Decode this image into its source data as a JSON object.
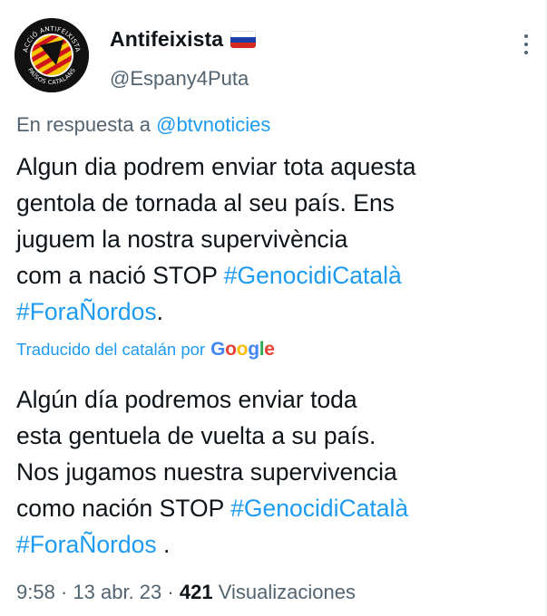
{
  "user": {
    "display_name": "Antifeixista",
    "handle": "@Espany4Puta",
    "flag_colors": [
      "#ffffff",
      "#1c3fa8",
      "#d52b1e"
    ],
    "avatar_texts": {
      "top": "ACCIÓ ANTIFEIXISTA",
      "bottom": "PAÏSOS CATALANS"
    }
  },
  "reply": {
    "prefix": "En respuesta a",
    "mention": "@btvnoticies"
  },
  "tweet": {
    "lines": [
      "Algun dia podrem enviar tota aquesta",
      "gentola de tornada al seu país. Ens",
      "juguem la nostra supervivència",
      "com a nació STOP "
    ],
    "hashtag1": "#GenocidiCatalà",
    "hashtag2": "#ForaÑordos",
    "end": "."
  },
  "translation": {
    "label": "Traducido del catalán por",
    "provider": "Google",
    "lines": [
      "Algún día podremos enviar toda",
      "esta gentuela de vuelta a su país.",
      "Nos jugamos nuestra supervivencia",
      "como nación STOP "
    ],
    "hashtag1": "#GenocidiCatalà",
    "hashtag2": "#ForaÑordos",
    "end": " ."
  },
  "meta": {
    "time": "9:58",
    "date": "13 abr. 23",
    "views_count": "421",
    "views_label": "Visualizaciones",
    "separator": "·"
  },
  "colors": {
    "accent": "#1d9bf0",
    "secondary_text": "#536471",
    "google": [
      "#4285F4",
      "#EA4335",
      "#FBBC05",
      "#4285F4",
      "#34A853",
      "#EA4335"
    ]
  }
}
